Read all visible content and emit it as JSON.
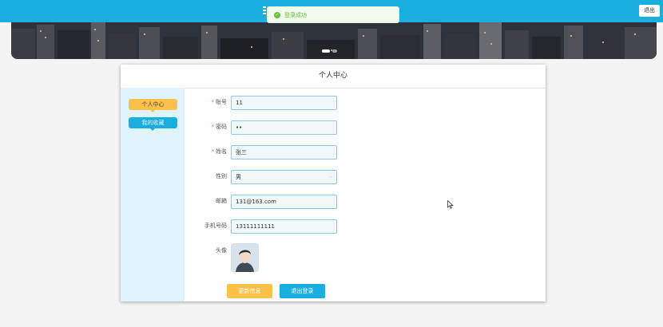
{
  "header": {
    "logout_label": "退出",
    "toast_text": "登录成功"
  },
  "profile": {
    "title": "个人中心",
    "sidebar": [
      "个人中心",
      "我的收藏"
    ],
    "fields": {
      "account": {
        "label": "账号",
        "value": "11"
      },
      "password": {
        "label": "密码",
        "value": "••"
      },
      "name": {
        "label": "姓名",
        "value": "张三"
      },
      "gender": {
        "label": "性别",
        "value": "男"
      },
      "email": {
        "label": "邮箱",
        "value": "131@163.com"
      },
      "phone": {
        "label": "手机号码",
        "value": "13111111111"
      },
      "avatar": {
        "label": "头像"
      }
    },
    "buttons": {
      "update": "更新信息",
      "logout": "退出登录"
    }
  },
  "colors": {
    "primary": "#1aaee0",
    "accent": "#fcc14b",
    "success": "#67c23a",
    "sidebar_bg": "#dff3fb"
  }
}
